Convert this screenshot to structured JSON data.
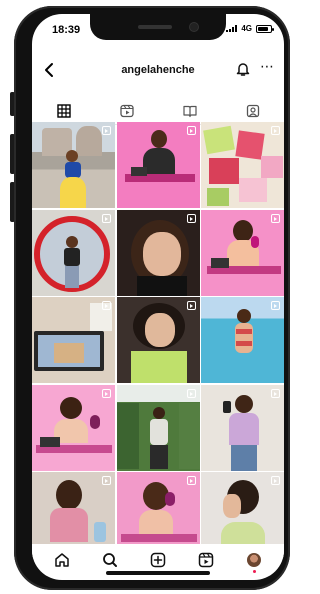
{
  "status_bar": {
    "time": "18:39",
    "network": "4G"
  },
  "profile": {
    "username": "angelahenche"
  },
  "tabs": [
    "posts-grid",
    "reels",
    "guides",
    "tagged"
  ],
  "grid": {
    "tiles": [
      {
        "scene": "castle-princess",
        "has_reel": true
      },
      {
        "scene": "pink-studio-desk",
        "has_reel": true
      },
      {
        "scene": "gift-boxes",
        "has_reel": true
      },
      {
        "scene": "ring-light-mirror",
        "has_reel": true
      },
      {
        "scene": "selfie-closeup",
        "has_reel": true
      },
      {
        "scene": "pink-podcast",
        "has_reel": true
      },
      {
        "scene": "tv-room",
        "has_reel": true
      },
      {
        "scene": "green-top",
        "has_reel": true
      },
      {
        "scene": "pool",
        "has_reel": true
      },
      {
        "scene": "pink-mic",
        "has_reel": true
      },
      {
        "scene": "garden-outfit",
        "has_reel": true
      },
      {
        "scene": "mirror-selfie",
        "has_reel": true
      },
      {
        "scene": "tank-top",
        "has_reel": true
      },
      {
        "scene": "pink-podcast-2",
        "has_reel": true
      },
      {
        "scene": "profile-side",
        "has_reel": true
      }
    ]
  },
  "bottom_nav": [
    "home",
    "search",
    "create",
    "reels",
    "profile"
  ],
  "colors": {
    "accent_pink": "#ee4fa1",
    "badge_red": "#ee1d52"
  }
}
